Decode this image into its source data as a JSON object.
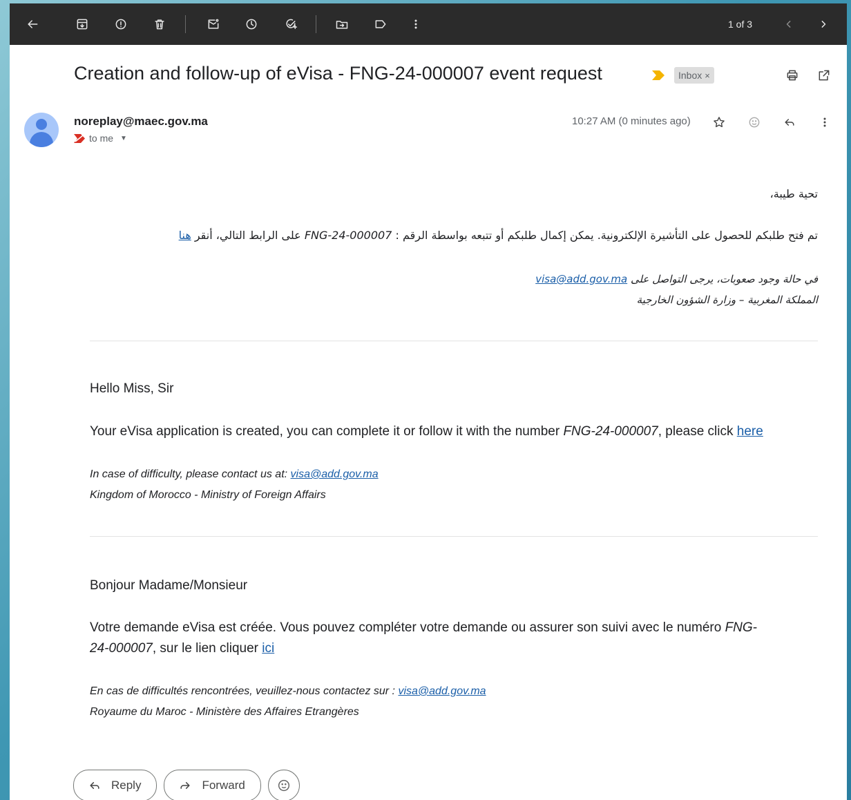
{
  "toolbar": {
    "pager": "1 of 3",
    "icons": [
      "back-arrow-icon",
      "archive-icon",
      "report-spam-icon",
      "delete-icon",
      "mark-unread-icon",
      "snooze-icon",
      "add-task-icon",
      "move-to-icon",
      "label-icon",
      "more-vert-icon",
      "prev-chevron-icon",
      "next-chevron-icon"
    ]
  },
  "message": {
    "subject": "Creation and follow-up of eVisa - FNG-24-000007 event request",
    "label": "Inbox",
    "label_close": "×",
    "sender": "noreplay@maec.gov.ma",
    "to": "to me",
    "time": "10:27 AM (0 minutes ago)"
  },
  "arabic": {
    "greeting": "تحية طيبة،",
    "line1_before": "تم فتح طلبكم للحصول على التأشيرة الإلكترونية. يمكن إكمال طلبكم أو تتبعه بواسطة الرقم : ",
    "line1_number": "FNG-24-000007",
    "line1_after": " على الرابط التالي، أنقر ",
    "line1_link": "هنا",
    "contact_before": "في حالة وجود صعوبات، يرجى التواصل على ",
    "contact_email": "visa@add.gov.ma",
    "signature": "المملكة المغربية – وزارة الشؤون الخارجية"
  },
  "english": {
    "greeting": "Hello Miss, Sir",
    "body_before": "Your eVisa application is created, you can complete it or follow it with the number ",
    "number": "FNG-24-000007",
    "body_after": ", please click ",
    "link": "here",
    "contact_before": "In case of difficulty, please contact us at: ",
    "contact_email": "visa@add.gov.ma",
    "signature": "Kingdom of Morocco - Ministry of Foreign Affairs"
  },
  "french": {
    "greeting": "Bonjour Madame/Monsieur",
    "body_before": "Votre demande eVisa est créée. Vous pouvez compléter votre demande ou assurer son suivi avec le numéro ",
    "number_part1": "FNG-",
    "number_part2": "24-000007",
    "body_after": ", sur le lien cliquer ",
    "link": "ici",
    "contact_before": "En cas de difficultés rencontrées, veuillez-nous contactez sur : ",
    "contact_email": "visa@add.gov.ma",
    "signature": "Royaume du Maroc - Ministère des Affaires Etrangères"
  },
  "actions": {
    "reply": "Reply",
    "forward": "Forward"
  },
  "colors": {
    "toolbar_bg": "#2b2b2b",
    "link": "#1a5ea8",
    "importance_marker": "#f4b400",
    "avatar": "#a8c7fa"
  }
}
